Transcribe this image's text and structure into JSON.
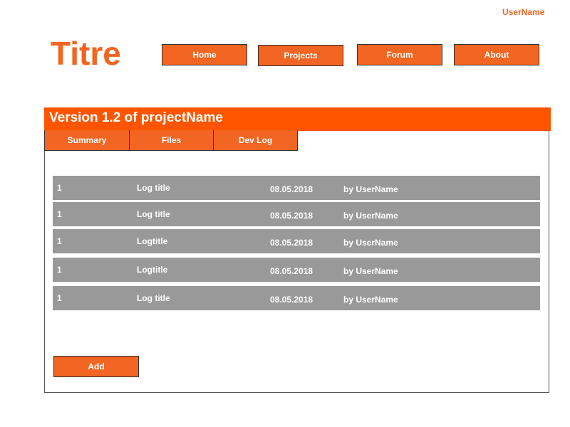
{
  "header": {
    "username": "UserName",
    "site_title": "Titre"
  },
  "nav": {
    "home": "Home",
    "projects": "Projects",
    "forum": "Forum",
    "about": "About"
  },
  "panel": {
    "title": "Version 1.2 of projectName",
    "tabs": [
      "Summary",
      "Files",
      "Dev Log"
    ]
  },
  "logs": [
    {
      "num": "1",
      "title": "Log title",
      "date": "08.05.2018",
      "author": "by UserName"
    },
    {
      "num": "1",
      "title": "Log title",
      "date": "08.05.2018",
      "author": "by UserName"
    },
    {
      "num": "1",
      "title": "Logtitle",
      "date": "08.05.2018",
      "author": "by UserName"
    },
    {
      "num": "1",
      "title": "Logtitle",
      "date": "08.05.2018",
      "author": "by UserName"
    },
    {
      "num": "1",
      "title": "Log title",
      "date": "08.05.2018",
      "author": "by UserName"
    }
  ],
  "actions": {
    "add_label": "Add"
  },
  "colors": {
    "accent": "#f26522",
    "header_bar": "#ff5500",
    "row_bg": "#999999"
  }
}
